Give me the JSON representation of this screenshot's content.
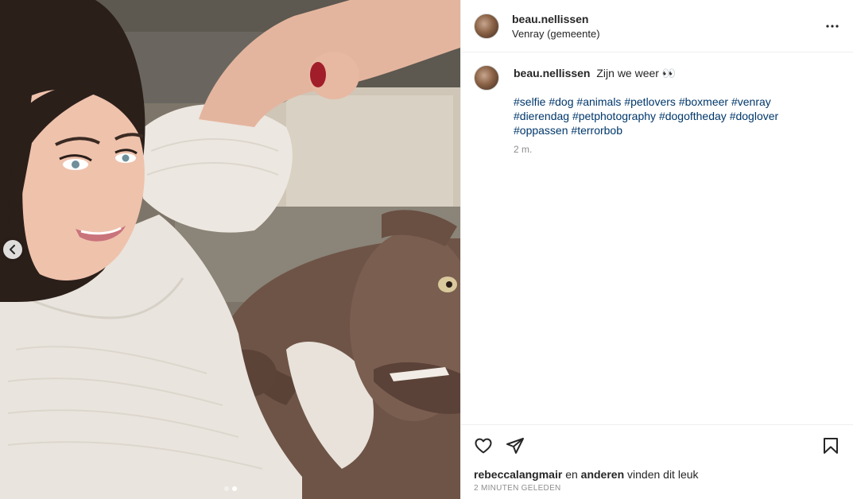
{
  "post": {
    "author": {
      "username": "beau.nellissen",
      "location": "Venray (gemeente)"
    },
    "caption": {
      "username": "beau.nellissen",
      "text": "Zijn we weer 👀",
      "hashtags": [
        "#selfie",
        "#dog",
        "#animals",
        "#petlovers",
        "#boxmeer",
        "#venray",
        "#dierendag",
        "#petphotography",
        "#dogoftheday",
        "#doglover",
        "#oppassen",
        "#terrorbob"
      ],
      "time_ago": "2 m."
    },
    "likes": {
      "first_user": "rebeccalangmair",
      "connector": "en",
      "others": "anderen",
      "suffix": "vinden dit leuk"
    },
    "date": "2 MINUTEN GELEDEN",
    "carousel": {
      "slides": 2,
      "active_index": 1
    }
  },
  "icons": {
    "more": "more-options-icon",
    "prev": "chevron-left-icon",
    "like": "heart-icon",
    "share": "paper-plane-icon",
    "save": "bookmark-icon"
  },
  "colors": {
    "hashtag": "#00376b",
    "muted": "#8e8e8e",
    "text": "#262626",
    "border": "#efefef"
  }
}
